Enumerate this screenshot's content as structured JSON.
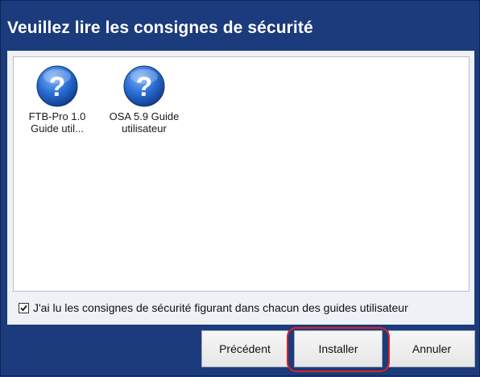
{
  "window": {
    "title": "Veuillez lire les consignes de sécurité"
  },
  "files": [
    {
      "label": "FTB-Pro 1.0\nGuide util...",
      "icon": "help-question-icon"
    },
    {
      "label": "OSA 5.9 Guide\nutilisateur",
      "icon": "help-question-icon"
    }
  ],
  "acknowledgement": {
    "checked": true,
    "label": "J'ai lu les consignes de sécurité figurant dans chacun des guides utilisateur"
  },
  "buttons": {
    "previous": "Précédent",
    "install": "Installer",
    "cancel": "Annuler"
  },
  "colors": {
    "background": "#1b3b7c",
    "highlight": "#e02020",
    "icon_blue": "#2a6ed6"
  }
}
